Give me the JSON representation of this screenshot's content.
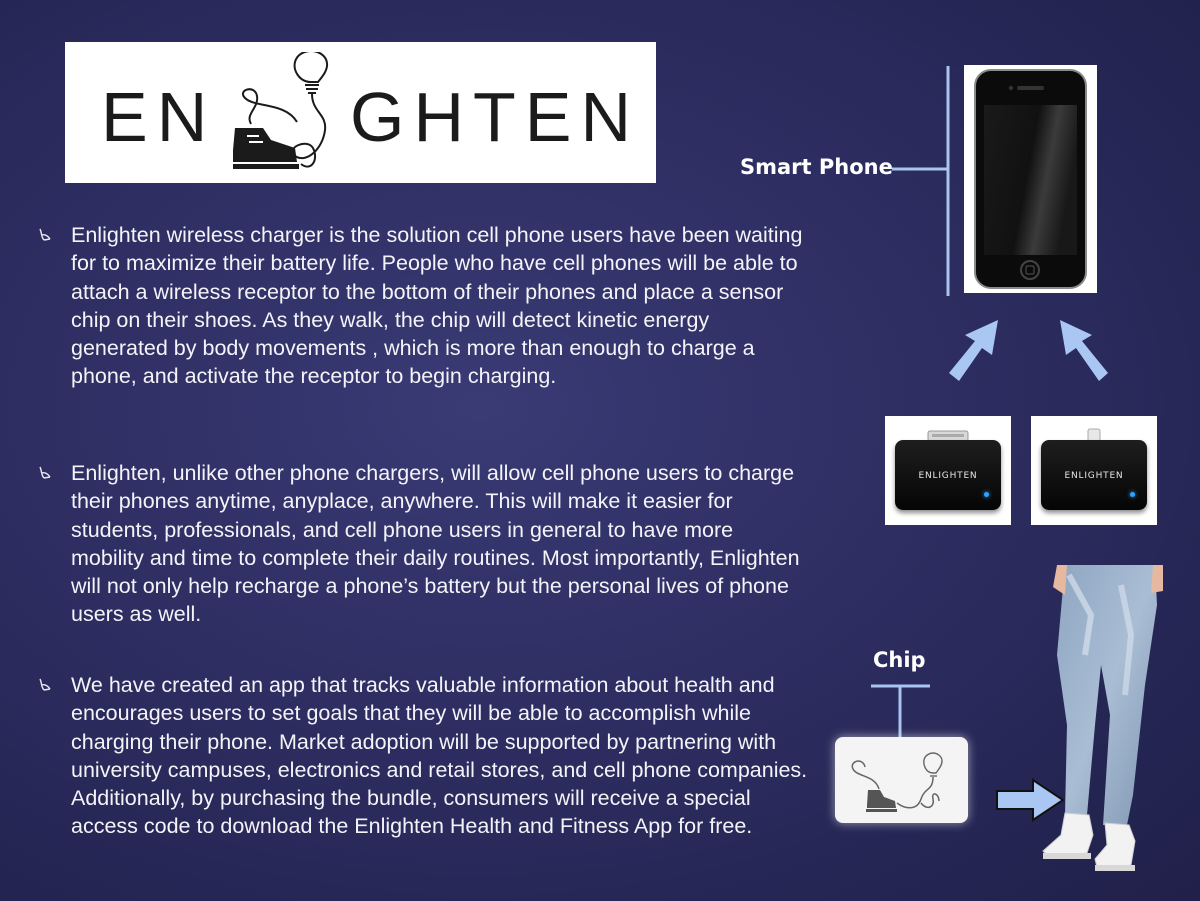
{
  "logo": {
    "text_left": "EN",
    "text_right": "GHTEN"
  },
  "bullets": [
    {
      "icon": "bullet-glyph-icon",
      "text": "Enlighten wireless charger is the solution cell phone users have been waiting for to maximize their battery life. People who have cell phones will be able to attach a wireless receptor to the bottom of their phones and place a sensor chip on their shoes. As they walk, the chip will detect kinetic energy generated by body movements , which is more than enough to charge a phone, and activate the receptor to begin charging."
    },
    {
      "icon": "bullet-glyph-icon",
      "text": "Enlighten, unlike other phone chargers, will allow cell phone users to charge their phones anytime, anyplace, anywhere. This will make it easier for students, professionals, and cell phone users in general to have more mobility and time to complete their daily routines. Most importantly, Enlighten will not only help recharge a phone’s battery but the personal lives of phone users as well."
    },
    {
      "icon": "bullet-glyph-icon",
      "text": "We have created an app that tracks valuable information about health and encourages users to set goals that they will be able to accomplish while charging their phone. Market adoption will be supported by partnering with university campuses, electronics and retail stores, and cell phone companies. Additionally, by purchasing the bundle, consumers will receive a special access code to download the Enlighten Health and Fitness App for free."
    }
  ],
  "labels": {
    "smart_phone": "Smart Phone",
    "chip": "Chip"
  },
  "chargers": [
    {
      "label": "ENLIGHTEN"
    },
    {
      "label": "ENLIGHTEN"
    }
  ],
  "colors": {
    "background": "#2b2b5e",
    "accent_line": "#a8c4f0",
    "arrow_fill": "#a9c7f2",
    "led": "#2fa2ff"
  }
}
